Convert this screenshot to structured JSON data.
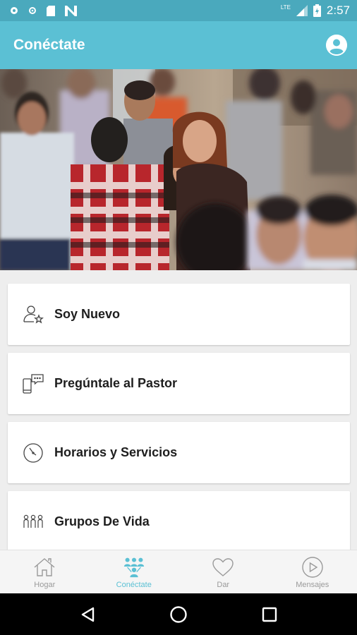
{
  "status_bar": {
    "time": "2:57",
    "network": "LTE",
    "icons": [
      "circle-notification-icon",
      "dot-notification-icon",
      "sd-card-icon",
      "n-app-icon",
      "signal-icon",
      "battery-icon"
    ]
  },
  "app_bar": {
    "title": "Conéctate",
    "profile_icon": "account-circle-icon"
  },
  "hero": {
    "image_description": "photo"
  },
  "menu": {
    "items": [
      {
        "label": "Soy Nuevo",
        "icon": "new-person-star-icon"
      },
      {
        "label": "Pregúntale al Pastor",
        "icon": "phone-chat-icon"
      },
      {
        "label": "Horarios y Servicios",
        "icon": "clock-icon"
      },
      {
        "label": "Grupos De Vida",
        "icon": "people-group-icon"
      }
    ]
  },
  "bottom_nav": {
    "items": [
      {
        "label": "Hogar",
        "icon": "home-icon",
        "active": false
      },
      {
        "label": "Conéctate",
        "icon": "connect-people-icon",
        "active": true
      },
      {
        "label": "Dar",
        "icon": "heart-icon",
        "active": false
      },
      {
        "label": "Mensajes",
        "icon": "play-circle-icon",
        "active": false
      }
    ]
  },
  "colors": {
    "status_bar": "#4aa9bd",
    "app_bar": "#5bc0d4",
    "accent": "#5bc0d4",
    "inactive": "#9a9a9a"
  }
}
